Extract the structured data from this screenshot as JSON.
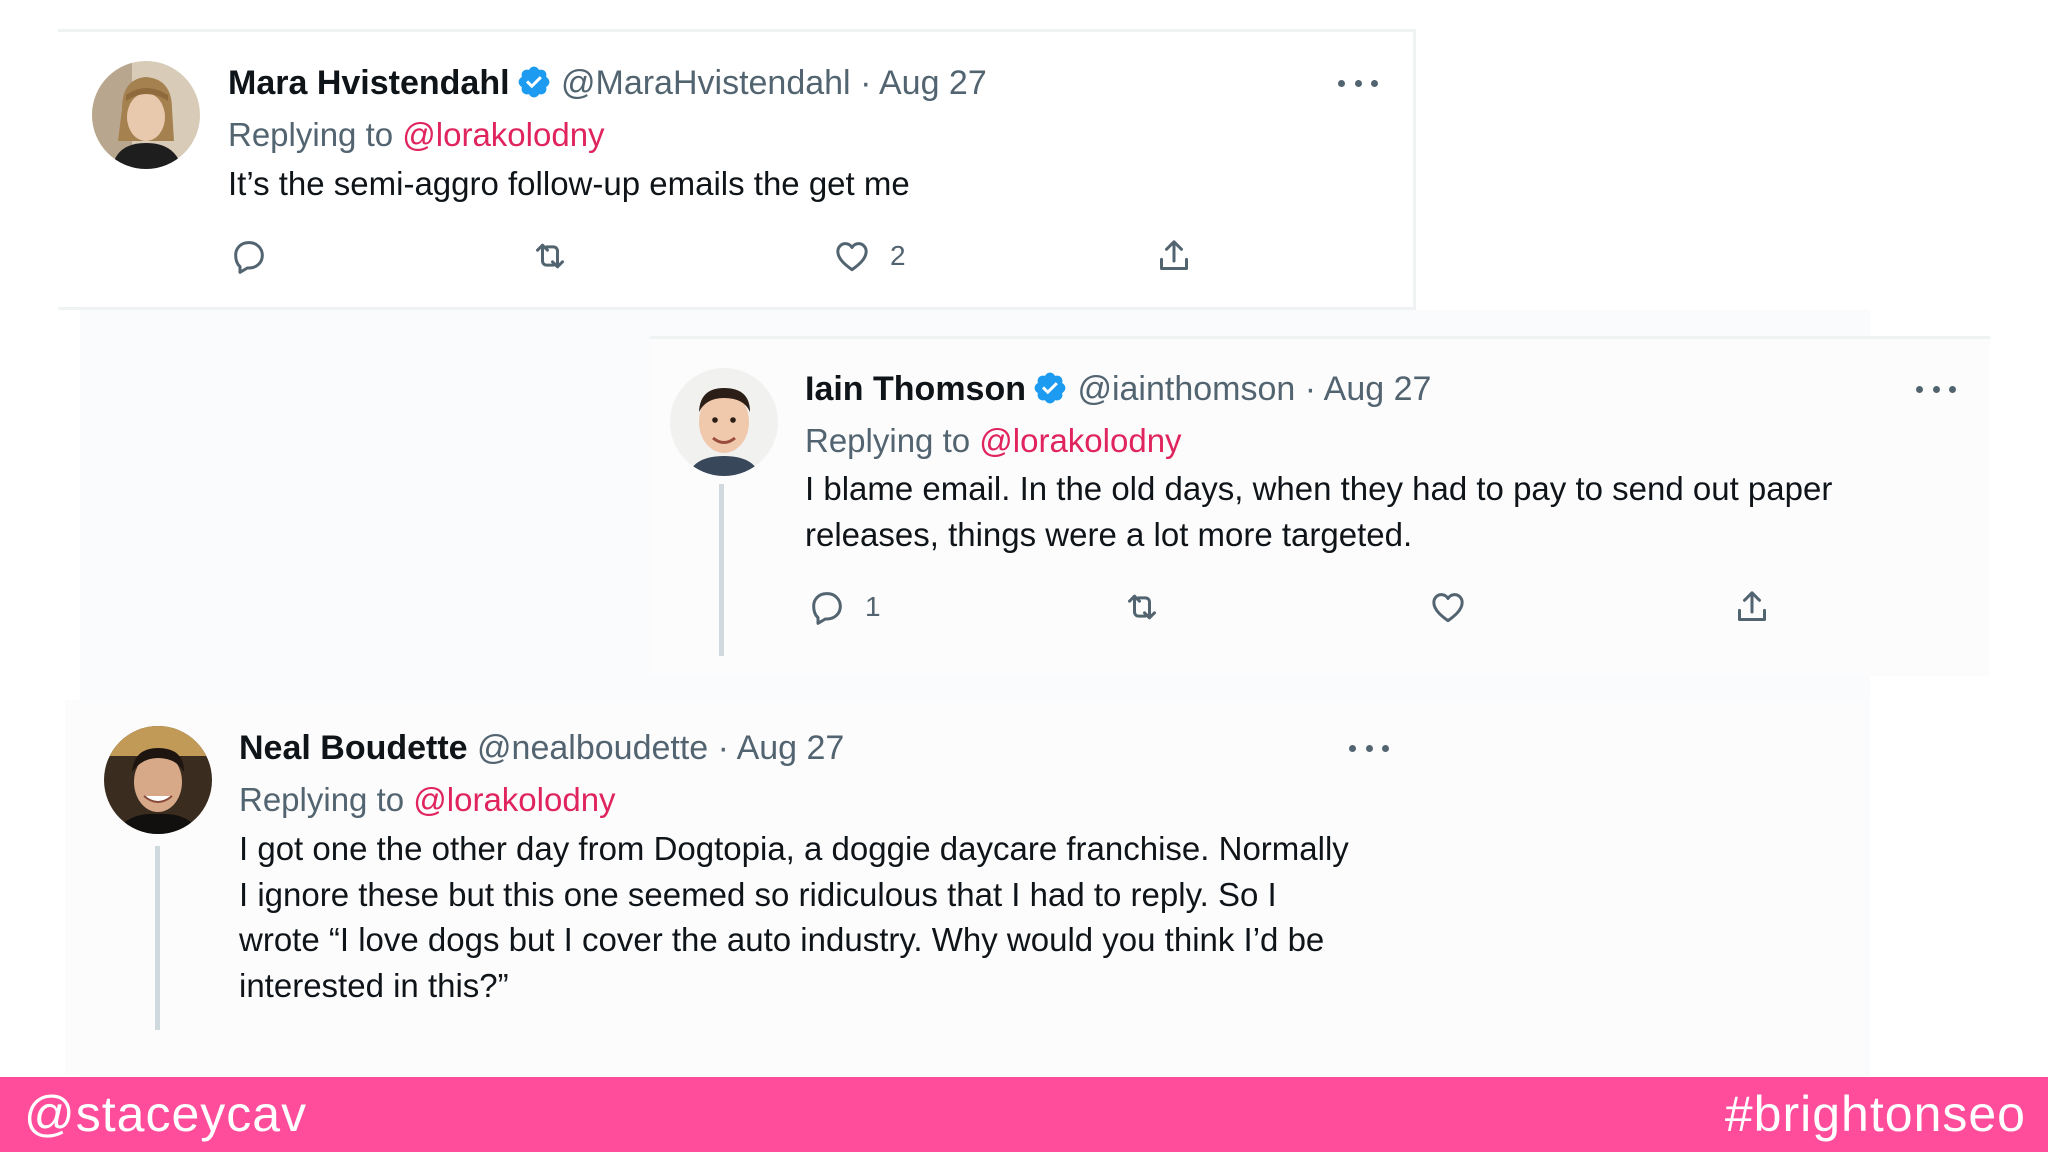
{
  "tweets": [
    {
      "name": "Mara Hvistendahl",
      "verified": true,
      "handle": "@MaraHvistendahl",
      "separator": "·",
      "date": "Aug 27",
      "replying_prefix": "Replying to",
      "replying_to": "@lorakolodny",
      "text": "It’s the semi-aggro follow-up emails the get me",
      "reply_count": "",
      "retweet_count": "",
      "like_count": "2"
    },
    {
      "name": "Iain Thomson",
      "verified": true,
      "handle": "@iainthomson",
      "separator": "·",
      "date": "Aug 27",
      "replying_prefix": "Replying to",
      "replying_to": "@lorakolodny",
      "text_lines": [
        "I blame email. In the old days, when they had to pay to send out paper",
        "releases, things were a lot more targeted."
      ],
      "reply_count": "1",
      "retweet_count": "",
      "like_count": ""
    },
    {
      "name": "Neal Boudette",
      "verified": false,
      "handle": "@nealboudette",
      "separator": "·",
      "date": "Aug 27",
      "replying_prefix": "Replying to",
      "replying_to": "@lorakolodny",
      "text_lines": [
        "I got one the other day from Dogtopia, a doggie daycare franchise. Normally",
        "I ignore these but this one seemed so ridiculous that I had to reply. So I",
        "wrote “I love dogs but I cover the auto industry. Why would you think I’d be",
        "interested in this?”"
      ]
    }
  ],
  "footer": {
    "left": "@staceycav",
    "right": "#brightonseo"
  },
  "colors": {
    "footer_bg": "#ff4c9b",
    "mention": "#e0245e",
    "verified": "#1d9bf0",
    "secondary_text": "#536471"
  },
  "icons": [
    "verified-badge-icon",
    "more-icon",
    "reply-icon",
    "retweet-icon",
    "like-icon",
    "share-icon"
  ]
}
